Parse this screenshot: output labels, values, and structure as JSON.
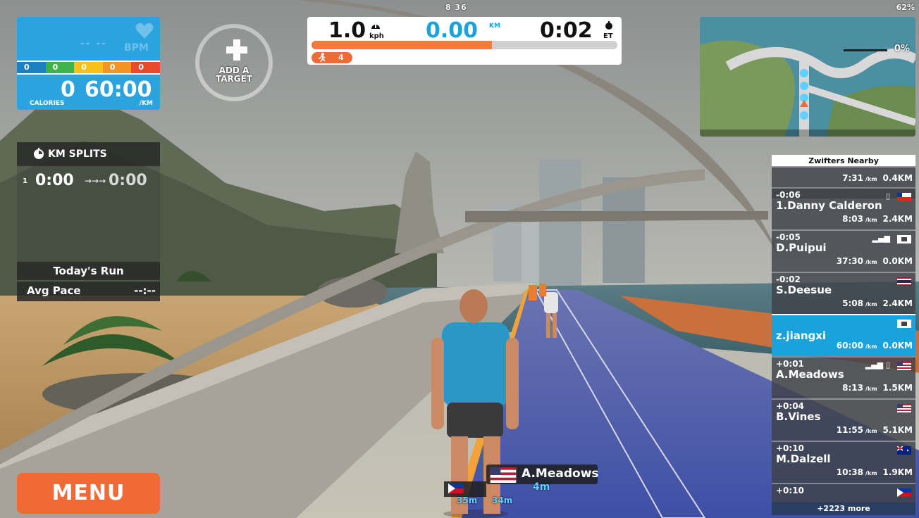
{
  "status": {
    "clock": "8 36",
    "battery": "62%"
  },
  "heart_panel": {
    "bpm_value": "-- --",
    "bpm_label": "BPM",
    "zones": [
      "0",
      "0",
      "0",
      "0",
      "0"
    ],
    "calories_value": "0",
    "calories_label": "CALORIES",
    "pace_value": "60:00",
    "pace_unit": "/KM"
  },
  "add_target": {
    "label": "ADD A TARGET"
  },
  "hud": {
    "speed": "1.0",
    "speed_unit": "kph",
    "distance": "0.00",
    "distance_unit": "KM",
    "time": "0:02",
    "time_unit": "ET",
    "progress": 0.59,
    "runners_count": "4"
  },
  "minimap": {
    "grade": "0%"
  },
  "splits": {
    "title": "KM SPLITS",
    "index": "1",
    "current": "0:00",
    "arrow": "→→→",
    "previous": "0:00"
  },
  "run_summary": {
    "title": "Today's Run",
    "avg_pace_label": "Avg Pace",
    "avg_pace_value": "--:--"
  },
  "menu": {
    "label": "MENU"
  },
  "nearby": {
    "title": "Zwifters Nearby",
    "more": "+2223 more",
    "rows": [
      {
        "gap": "",
        "name": "",
        "pace": "7:31",
        "pace_unit": "/km",
        "dist": "0.4KM",
        "flag": "",
        "device": ""
      },
      {
        "gap": "-0:06",
        "name": "1.Danny Calderon",
        "pace": "8:03",
        "pace_unit": "/km",
        "dist": "2.4KM",
        "flag": "chile",
        "device": "phone"
      },
      {
        "gap": "-0:05",
        "name": "D.Puipui",
        "pace": "37:30",
        "pace_unit": "/km",
        "dist": "0.0KM",
        "flag": "generic",
        "device": "bars"
      },
      {
        "gap": "-0:02",
        "name": "S.Deesue",
        "pace": "5:08",
        "pace_unit": "/km",
        "dist": "2.4KM",
        "flag": "thailand",
        "device": ""
      },
      {
        "gap": "",
        "name": "z.jiangxi",
        "pace": "60:00",
        "pace_unit": "/km",
        "dist": "0.0KM",
        "flag": "generic",
        "device": ""
      },
      {
        "gap": "+0:01",
        "name": "A.Meadows",
        "pace": "8:13",
        "pace_unit": "/km",
        "dist": "1.5KM",
        "flag": "usa",
        "device": "bars"
      },
      {
        "gap": "+0:04",
        "name": "B.Vines",
        "pace": "11:55",
        "pace_unit": "/km",
        "dist": "5.1KM",
        "flag": "usa",
        "device": ""
      },
      {
        "gap": "+0:10",
        "name": "M.Dalzell",
        "pace": "10:38",
        "pace_unit": "/km",
        "dist": "1.9KM",
        "flag": "australia",
        "device": ""
      },
      {
        "gap": "+0:10",
        "name": "",
        "pace": "",
        "pace_unit": "",
        "dist": "",
        "flag": "philippines",
        "device": ""
      }
    ]
  },
  "name_tags": {
    "main_name": "A.Meadows",
    "main_dist": "4m",
    "tag2_dist": "34m",
    "tag3_dist": "35m"
  },
  "colors": {
    "accent_orange": "#f06a35",
    "accent_blue": "#1aa2dc",
    "zone_colors": [
      "#1c7fc0",
      "#3fb34a",
      "#f4c019",
      "#f39322",
      "#e94b2a"
    ]
  }
}
